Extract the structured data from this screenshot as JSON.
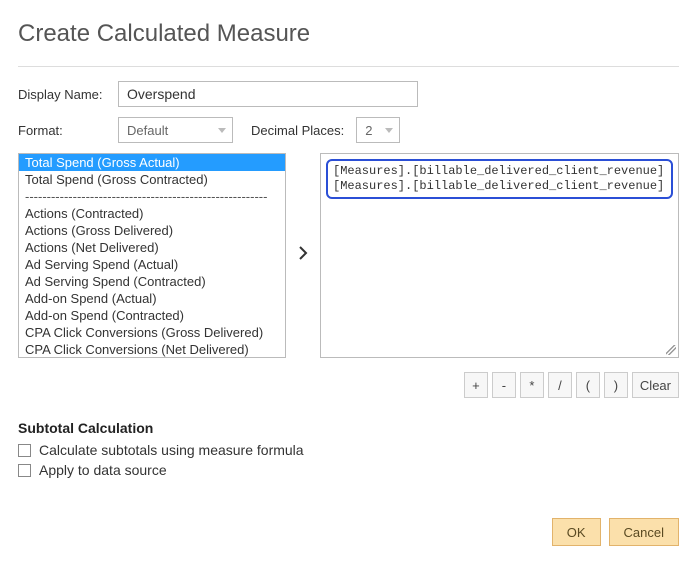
{
  "dialog": {
    "title": "Create Calculated Measure",
    "displayName": {
      "label": "Display Name:",
      "value": "Overspend"
    },
    "format": {
      "label": "Format:",
      "value": "Default"
    },
    "decimalPlaces": {
      "label": "Decimal Places:",
      "value": "2"
    },
    "measures": {
      "selectedIndex": 0,
      "items": [
        "Total Spend (Gross Actual)",
        "Total Spend (Gross Contracted)",
        "__divider__",
        "Actions (Contracted)",
        "Actions (Gross Delivered)",
        "Actions (Net Delivered)",
        "Ad Serving Spend (Actual)",
        "Ad Serving Spend (Contracted)",
        "Add-on Spend (Actual)",
        "Add-on Spend (Contracted)",
        "CPA Click Conversions (Gross Delivered)",
        "CPA Click Conversions (Net Delivered)"
      ]
    },
    "formula": {
      "lines": [
        "[Measures].[billable_delivered_client_revenue]",
        "[Measures].[billable_delivered_client_revenue]"
      ]
    },
    "operators": {
      "plus": "+",
      "minus": "-",
      "mult": "*",
      "div": "/",
      "lparen": "(",
      "rparen": ")",
      "clear": "Clear"
    },
    "subtotal": {
      "heading": "Subtotal Calculation",
      "opt1": "Calculate subtotals using measure formula",
      "opt2": "Apply to data source"
    },
    "buttons": {
      "ok": "OK",
      "cancel": "Cancel"
    }
  }
}
